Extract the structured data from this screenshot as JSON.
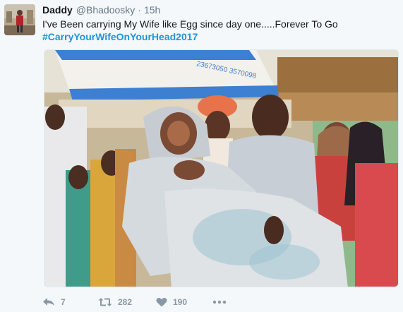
{
  "tweet": {
    "name": "Daddy",
    "handle": "@Bhadoosky",
    "separator": "·",
    "time": "15h",
    "text": "I've Been carrying My Wife like Egg since day one.....Forever To Go",
    "hashtag": "#CarryYourWifeOnYourHead2017"
  },
  "photo": {
    "sign_text": "23673050 3570098"
  },
  "actions": {
    "reply_count": "7",
    "retweet_count": "282",
    "like_count": "190"
  },
  "icons": {
    "reply": "reply-icon",
    "retweet": "retweet-icon",
    "like": "heart-icon",
    "more": "more-icon"
  },
  "colors": {
    "link": "#1b95e0",
    "muted": "#657786",
    "action": "#8899a6",
    "background": "#f5f8fa"
  }
}
